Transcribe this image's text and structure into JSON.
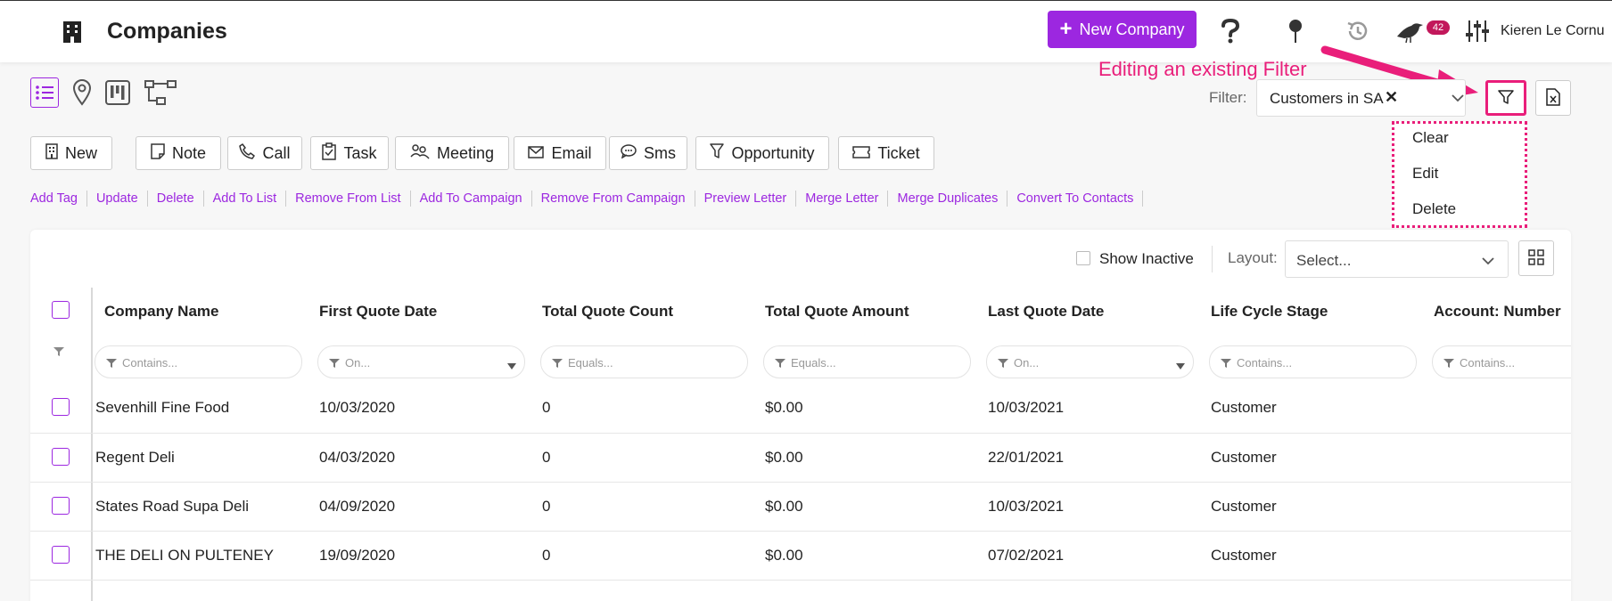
{
  "header": {
    "title": "Companies",
    "new_button_label": "New Company",
    "notification_count": "42",
    "user_name": "Kieren Le Cornu"
  },
  "annotation": {
    "text": "Editing an existing Filter",
    "color": "#e91e7a"
  },
  "filter": {
    "label": "Filter:",
    "value": "Customers in SA",
    "menu": [
      "Clear",
      "Edit",
      "Delete"
    ]
  },
  "actions": {
    "new": "New",
    "note": "Note",
    "call": "Call",
    "task": "Task",
    "meeting": "Meeting",
    "email": "Email",
    "sms": "Sms",
    "opportunity": "Opportunity",
    "ticket": "Ticket"
  },
  "links": [
    "Add Tag",
    "Update",
    "Delete",
    "Add To List",
    "Remove From List",
    "Add To Campaign",
    "Remove From Campaign",
    "Preview Letter",
    "Merge Letter",
    "Merge Duplicates",
    "Convert To Contacts"
  ],
  "table_controls": {
    "show_inactive": "Show Inactive",
    "layout_label": "Layout:",
    "layout_placeholder": "Select..."
  },
  "columns": [
    {
      "label": "Company Name",
      "filter": "Contains..."
    },
    {
      "label": "First Quote Date",
      "filter": "On..."
    },
    {
      "label": "Total Quote Count",
      "filter": "Equals..."
    },
    {
      "label": "Total Quote Amount",
      "filter": "Equals..."
    },
    {
      "label": "Last Quote Date",
      "filter": "On..."
    },
    {
      "label": "Life Cycle Stage",
      "filter": "Contains..."
    },
    {
      "label": "Account: Number",
      "filter": "Contains..."
    }
  ],
  "rows": [
    [
      "Sevenhill Fine Food",
      "10/03/2020",
      "0",
      "$0.00",
      "10/03/2021",
      "Customer"
    ],
    [
      "Regent Deli",
      "04/03/2020",
      "0",
      "$0.00",
      "22/01/2021",
      "Customer"
    ],
    [
      "States Road Supa Deli",
      "04/09/2020",
      "0",
      "$0.00",
      "10/03/2021",
      "Customer"
    ],
    [
      "THE DELI ON PULTENEY",
      "19/09/2020",
      "0",
      "$0.00",
      "07/02/2021",
      "Customer"
    ]
  ],
  "colors": {
    "accent": "#9c27e0",
    "annotation": "#e91e7a",
    "badge": "#c2185b"
  }
}
